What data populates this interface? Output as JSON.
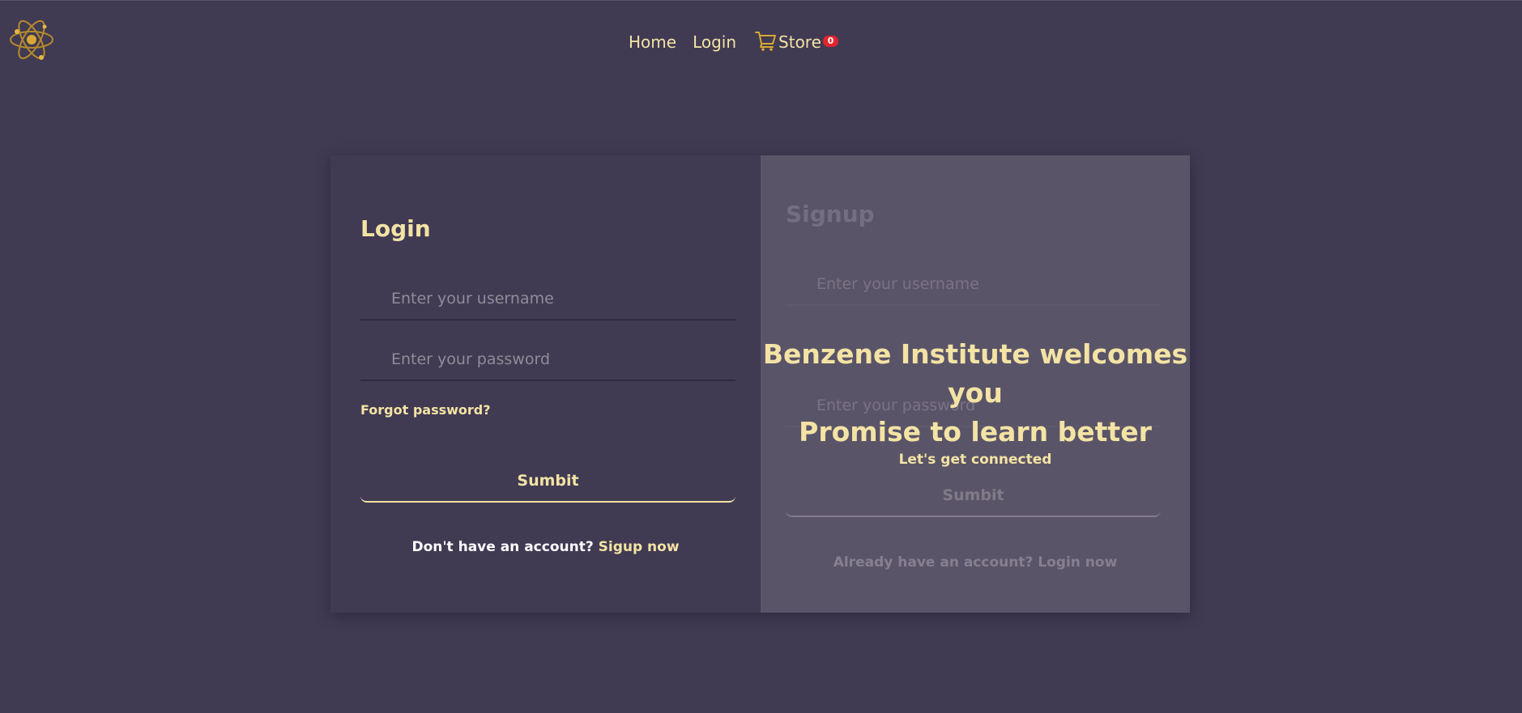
{
  "nav": {
    "home": "Home",
    "login": "Login",
    "store": "Store",
    "cart_count": "0"
  },
  "login_form": {
    "title": "Login",
    "username_placeholder": "Enter your username",
    "password_placeholder": "Enter your password",
    "forgot": "Forgot password?",
    "submit": "Sumbit",
    "switch_text": "Don't have an account?",
    "switch_link": "Sigup now"
  },
  "signup_form": {
    "title": "Signup",
    "username_placeholder": "Enter your username",
    "password_placeholder": "Enter your password",
    "submit": "Sumbit",
    "switch_text": "Already have an account?",
    "switch_link": "Login now"
  },
  "overlay": {
    "line1": "Benzene Institute welcomes you",
    "line2": "Promise to learn better",
    "line3": "Let's get connected"
  },
  "colors": {
    "background": "#403a53",
    "accent": "#f3e3a4",
    "overlay_panel": "#5a5468",
    "badge": "#e0262d"
  },
  "icons": {
    "logo": "atom-logo-icon",
    "cart": "shopping-cart-icon"
  }
}
